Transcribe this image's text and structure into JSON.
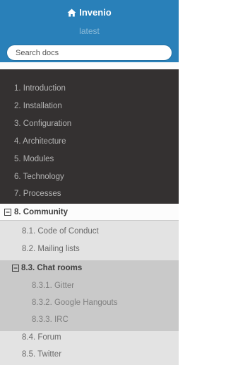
{
  "header": {
    "brand": "Invenio",
    "brand_icon": "home-icon",
    "version": "latest",
    "search_placeholder": "Search docs",
    "color": "#2980b9"
  },
  "menu": {
    "items": [
      {
        "label": "1. Introduction"
      },
      {
        "label": "2. Installation"
      },
      {
        "label": "3. Configuration"
      },
      {
        "label": "4. Architecture"
      },
      {
        "label": "5. Modules"
      },
      {
        "label": "6. Technology"
      },
      {
        "label": "7. Processes"
      }
    ],
    "current": {
      "label": "8. Community",
      "icon": "minus-square-icon",
      "children": [
        {
          "label": "8.1. Code of Conduct"
        },
        {
          "label": "8.2. Mailing lists"
        },
        {
          "label": "8.3. Chat rooms",
          "icon": "minus-square-icon",
          "children": [
            {
              "label": "8.3.1. Gitter"
            },
            {
              "label": "8.3.2. Google Hangouts"
            },
            {
              "label": "8.3.3. IRC"
            }
          ]
        },
        {
          "label": "8.4. Forum"
        },
        {
          "label": "8.5. Twitter"
        }
      ]
    }
  }
}
